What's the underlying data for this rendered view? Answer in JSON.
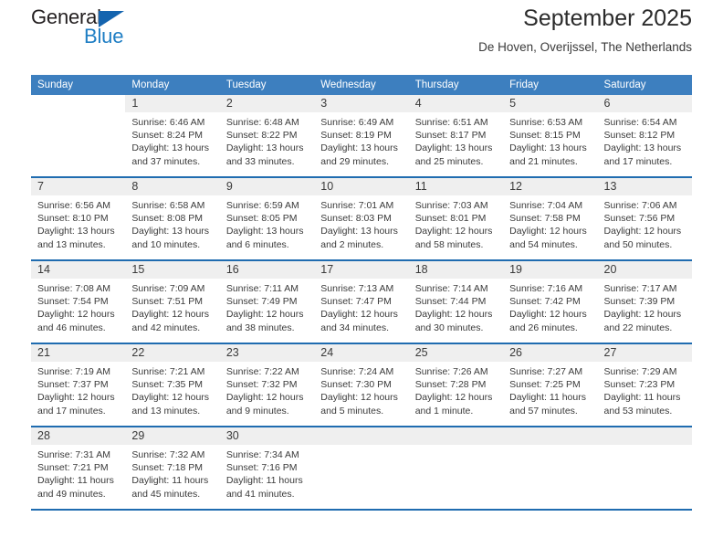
{
  "logo": {
    "text_dark": "General",
    "text_blue": "Blue",
    "triangle_color": "#1464af",
    "blue_color": "#1f7ec4"
  },
  "header": {
    "title": "September 2025",
    "subtitle": "De Hoven, Overijssel, The Netherlands"
  },
  "theme": {
    "header_bg": "#3d7fbf",
    "row_separator": "#1f6cb0",
    "daynum_bg": "#efefef"
  },
  "weekdays": [
    "Sunday",
    "Monday",
    "Tuesday",
    "Wednesday",
    "Thursday",
    "Friday",
    "Saturday"
  ],
  "weeks": [
    [
      {
        "day": "",
        "sunrise": "",
        "sunset": "",
        "daylight": "",
        "daylight2": "",
        "blank": true
      },
      {
        "day": "1",
        "sunrise": "Sunrise: 6:46 AM",
        "sunset": "Sunset: 8:24 PM",
        "daylight": "Daylight: 13 hours",
        "daylight2": "and 37 minutes."
      },
      {
        "day": "2",
        "sunrise": "Sunrise: 6:48 AM",
        "sunset": "Sunset: 8:22 PM",
        "daylight": "Daylight: 13 hours",
        "daylight2": "and 33 minutes."
      },
      {
        "day": "3",
        "sunrise": "Sunrise: 6:49 AM",
        "sunset": "Sunset: 8:19 PM",
        "daylight": "Daylight: 13 hours",
        "daylight2": "and 29 minutes."
      },
      {
        "day": "4",
        "sunrise": "Sunrise: 6:51 AM",
        "sunset": "Sunset: 8:17 PM",
        "daylight": "Daylight: 13 hours",
        "daylight2": "and 25 minutes."
      },
      {
        "day": "5",
        "sunrise": "Sunrise: 6:53 AM",
        "sunset": "Sunset: 8:15 PM",
        "daylight": "Daylight: 13 hours",
        "daylight2": "and 21 minutes."
      },
      {
        "day": "6",
        "sunrise": "Sunrise: 6:54 AM",
        "sunset": "Sunset: 8:12 PM",
        "daylight": "Daylight: 13 hours",
        "daylight2": "and 17 minutes."
      }
    ],
    [
      {
        "day": "7",
        "sunrise": "Sunrise: 6:56 AM",
        "sunset": "Sunset: 8:10 PM",
        "daylight": "Daylight: 13 hours",
        "daylight2": "and 13 minutes."
      },
      {
        "day": "8",
        "sunrise": "Sunrise: 6:58 AM",
        "sunset": "Sunset: 8:08 PM",
        "daylight": "Daylight: 13 hours",
        "daylight2": "and 10 minutes."
      },
      {
        "day": "9",
        "sunrise": "Sunrise: 6:59 AM",
        "sunset": "Sunset: 8:05 PM",
        "daylight": "Daylight: 13 hours",
        "daylight2": "and 6 minutes."
      },
      {
        "day": "10",
        "sunrise": "Sunrise: 7:01 AM",
        "sunset": "Sunset: 8:03 PM",
        "daylight": "Daylight: 13 hours",
        "daylight2": "and 2 minutes."
      },
      {
        "day": "11",
        "sunrise": "Sunrise: 7:03 AM",
        "sunset": "Sunset: 8:01 PM",
        "daylight": "Daylight: 12 hours",
        "daylight2": "and 58 minutes."
      },
      {
        "day": "12",
        "sunrise": "Sunrise: 7:04 AM",
        "sunset": "Sunset: 7:58 PM",
        "daylight": "Daylight: 12 hours",
        "daylight2": "and 54 minutes."
      },
      {
        "day": "13",
        "sunrise": "Sunrise: 7:06 AM",
        "sunset": "Sunset: 7:56 PM",
        "daylight": "Daylight: 12 hours",
        "daylight2": "and 50 minutes."
      }
    ],
    [
      {
        "day": "14",
        "sunrise": "Sunrise: 7:08 AM",
        "sunset": "Sunset: 7:54 PM",
        "daylight": "Daylight: 12 hours",
        "daylight2": "and 46 minutes."
      },
      {
        "day": "15",
        "sunrise": "Sunrise: 7:09 AM",
        "sunset": "Sunset: 7:51 PM",
        "daylight": "Daylight: 12 hours",
        "daylight2": "and 42 minutes."
      },
      {
        "day": "16",
        "sunrise": "Sunrise: 7:11 AM",
        "sunset": "Sunset: 7:49 PM",
        "daylight": "Daylight: 12 hours",
        "daylight2": "and 38 minutes."
      },
      {
        "day": "17",
        "sunrise": "Sunrise: 7:13 AM",
        "sunset": "Sunset: 7:47 PM",
        "daylight": "Daylight: 12 hours",
        "daylight2": "and 34 minutes."
      },
      {
        "day": "18",
        "sunrise": "Sunrise: 7:14 AM",
        "sunset": "Sunset: 7:44 PM",
        "daylight": "Daylight: 12 hours",
        "daylight2": "and 30 minutes."
      },
      {
        "day": "19",
        "sunrise": "Sunrise: 7:16 AM",
        "sunset": "Sunset: 7:42 PM",
        "daylight": "Daylight: 12 hours",
        "daylight2": "and 26 minutes."
      },
      {
        "day": "20",
        "sunrise": "Sunrise: 7:17 AM",
        "sunset": "Sunset: 7:39 PM",
        "daylight": "Daylight: 12 hours",
        "daylight2": "and 22 minutes."
      }
    ],
    [
      {
        "day": "21",
        "sunrise": "Sunrise: 7:19 AM",
        "sunset": "Sunset: 7:37 PM",
        "daylight": "Daylight: 12 hours",
        "daylight2": "and 17 minutes."
      },
      {
        "day": "22",
        "sunrise": "Sunrise: 7:21 AM",
        "sunset": "Sunset: 7:35 PM",
        "daylight": "Daylight: 12 hours",
        "daylight2": "and 13 minutes."
      },
      {
        "day": "23",
        "sunrise": "Sunrise: 7:22 AM",
        "sunset": "Sunset: 7:32 PM",
        "daylight": "Daylight: 12 hours",
        "daylight2": "and 9 minutes."
      },
      {
        "day": "24",
        "sunrise": "Sunrise: 7:24 AM",
        "sunset": "Sunset: 7:30 PM",
        "daylight": "Daylight: 12 hours",
        "daylight2": "and 5 minutes."
      },
      {
        "day": "25",
        "sunrise": "Sunrise: 7:26 AM",
        "sunset": "Sunset: 7:28 PM",
        "daylight": "Daylight: 12 hours",
        "daylight2": "and 1 minute."
      },
      {
        "day": "26",
        "sunrise": "Sunrise: 7:27 AM",
        "sunset": "Sunset: 7:25 PM",
        "daylight": "Daylight: 11 hours",
        "daylight2": "and 57 minutes."
      },
      {
        "day": "27",
        "sunrise": "Sunrise: 7:29 AM",
        "sunset": "Sunset: 7:23 PM",
        "daylight": "Daylight: 11 hours",
        "daylight2": "and 53 minutes."
      }
    ],
    [
      {
        "day": "28",
        "sunrise": "Sunrise: 7:31 AM",
        "sunset": "Sunset: 7:21 PM",
        "daylight": "Daylight: 11 hours",
        "daylight2": "and 49 minutes."
      },
      {
        "day": "29",
        "sunrise": "Sunrise: 7:32 AM",
        "sunset": "Sunset: 7:18 PM",
        "daylight": "Daylight: 11 hours",
        "daylight2": "and 45 minutes."
      },
      {
        "day": "30",
        "sunrise": "Sunrise: 7:34 AM",
        "sunset": "Sunset: 7:16 PM",
        "daylight": "Daylight: 11 hours",
        "daylight2": "and 41 minutes."
      },
      {
        "day": "",
        "sunrise": "",
        "sunset": "",
        "daylight": "",
        "daylight2": "",
        "empty": true
      },
      {
        "day": "",
        "sunrise": "",
        "sunset": "",
        "daylight": "",
        "daylight2": "",
        "empty": true
      },
      {
        "day": "",
        "sunrise": "",
        "sunset": "",
        "daylight": "",
        "daylight2": "",
        "empty": true
      },
      {
        "day": "",
        "sunrise": "",
        "sunset": "",
        "daylight": "",
        "daylight2": "",
        "empty": true
      }
    ]
  ]
}
